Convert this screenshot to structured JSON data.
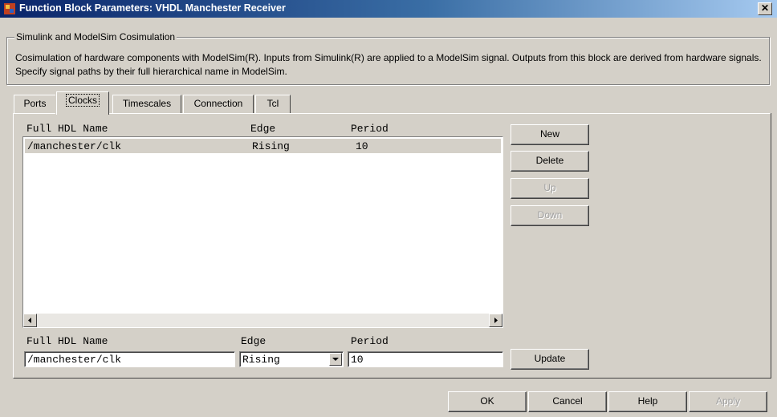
{
  "window": {
    "title": "Function Block Parameters: VHDL Manchester Receiver",
    "close_glyph": "✕"
  },
  "group": {
    "title": "Simulink and ModelSim Cosimulation",
    "description": "Cosimulation of hardware components with ModelSim(R). Inputs from Simulink(R) are applied to a ModelSim signal. Outputs from this block are derived from hardware signals. Specify signal paths by their full hierarchical name in ModelSim."
  },
  "tabs": [
    {
      "label": "Ports"
    },
    {
      "label": "Clocks",
      "active": true
    },
    {
      "label": "Timescales"
    },
    {
      "label": "Connection"
    },
    {
      "label": "Tcl"
    }
  ],
  "table": {
    "headers": [
      "Full HDL Name",
      "Edge",
      "Period"
    ],
    "rows": [
      {
        "name": "/manchester/clk",
        "edge": "Rising",
        "period": "10"
      }
    ]
  },
  "side_buttons": {
    "new": "New",
    "delete": "Delete",
    "up": "Up",
    "down": "Down"
  },
  "editor": {
    "name_label": "Full HDL Name",
    "edge_label": "Edge",
    "period_label": "Period",
    "name_value": "/manchester/clk",
    "edge_value": "Rising",
    "period_value": "10",
    "update": "Update"
  },
  "footer": {
    "ok": "OK",
    "cancel": "Cancel",
    "help": "Help",
    "apply": "Apply"
  },
  "icons": {
    "app": "simulink-block-icon",
    "close": "close-icon",
    "scroll_left": "arrow-left-icon",
    "scroll_right": "arrow-right-icon",
    "dropdown": "arrow-down-icon"
  }
}
